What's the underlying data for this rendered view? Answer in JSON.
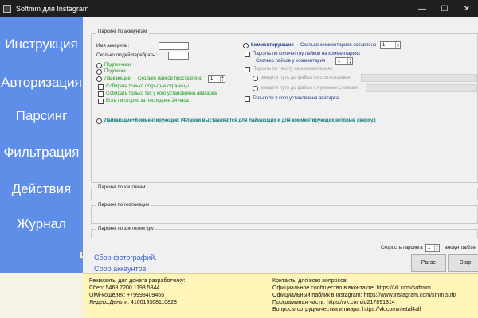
{
  "window": {
    "title": "Softmm для  Instagram",
    "minimize": "—",
    "maximize": "☐",
    "close": "✕"
  },
  "sidebar": {
    "items": [
      {
        "label": "Инструкция"
      },
      {
        "label": "Авторизация"
      },
      {
        "label": "Парсинг"
      },
      {
        "label": "Фильтрация"
      },
      {
        "label": "Действия"
      },
      {
        "label": "Журнал"
      }
    ],
    "collapse_glyph": "b"
  },
  "accounts_group": {
    "title": "Парсинг по аккаунтам",
    "account_name_label": "Имя аккаунта :",
    "account_name_value": "",
    "people_count_label": "Сколько людей перебрать :",
    "people_count_value": "",
    "subscribers": "Подписчики",
    "subscriptions": "Подписки",
    "likers": "Лайкающие:",
    "likes_set_label": "Сколько лайков проставлено",
    "likes_set_value": "1",
    "open_pages_only": "Собирать только открытые страницы",
    "avatar_only": "Собирать только тех у кого установлена аватарка",
    "stories_24h": "Есть ли сторис за последние 24 часа",
    "commenters": "Комментирующие",
    "comments_left_label": "Сколько комментариев оставлено",
    "comments_left_value": "1",
    "parse_by_comment_likes": "Парсить по количеству лайков на комментариях",
    "comment_likes_label": "Сколько лайков у комментария",
    "comment_likes_value": "1",
    "parse_by_comment_text": "Парсить по тексту на комментариях",
    "stop_words_path": "введите путь до файла со стоп-словами",
    "needed_words_path": "введите путь до файла с нужными словами",
    "avatar_only_commenters": "Только те у кого установлена аватарка",
    "likers_commenters": "Лайкающие+Комментирующие: (Флажки выставляются для лайкающих и для комментирующих которые сверху.)"
  },
  "hashtag_group": {
    "title": "Парсинг по хештегам"
  },
  "geo_group": {
    "title": "Парсинг по геолокации"
  },
  "igtv_group": {
    "title": "Парсинг по зрителям igtv"
  },
  "speed": {
    "label": "Скорость парсинга",
    "value": "1",
    "suffix": "аккаунтов/2се"
  },
  "buttons": {
    "parse": "Parse",
    "stop": "Stop"
  },
  "links": {
    "collect_photos": "Сбор фотографий.",
    "collect_accounts": "Сбор аккаунтов."
  },
  "footer": {
    "left": [
      "Реквизиты для доната разработчику:",
      "Сбер: 5469 7200 1193 5844",
      "Qiwi-кошелек: +79998409465",
      "Яндекс.Деньги: 410019308110828"
    ],
    "right": [
      "Контакты для всех вопросов:",
      "Официальное сообщество в вконтакте: https://vk.com/softmm",
      "Официальный паблик в Instagram: https://www.instagram.com/smm.s0ft/",
      "Программная часть: https://vk.com/id217891314",
      "Вопросы сотрудничества и пиара: https://vk.com/metal4all"
    ]
  }
}
